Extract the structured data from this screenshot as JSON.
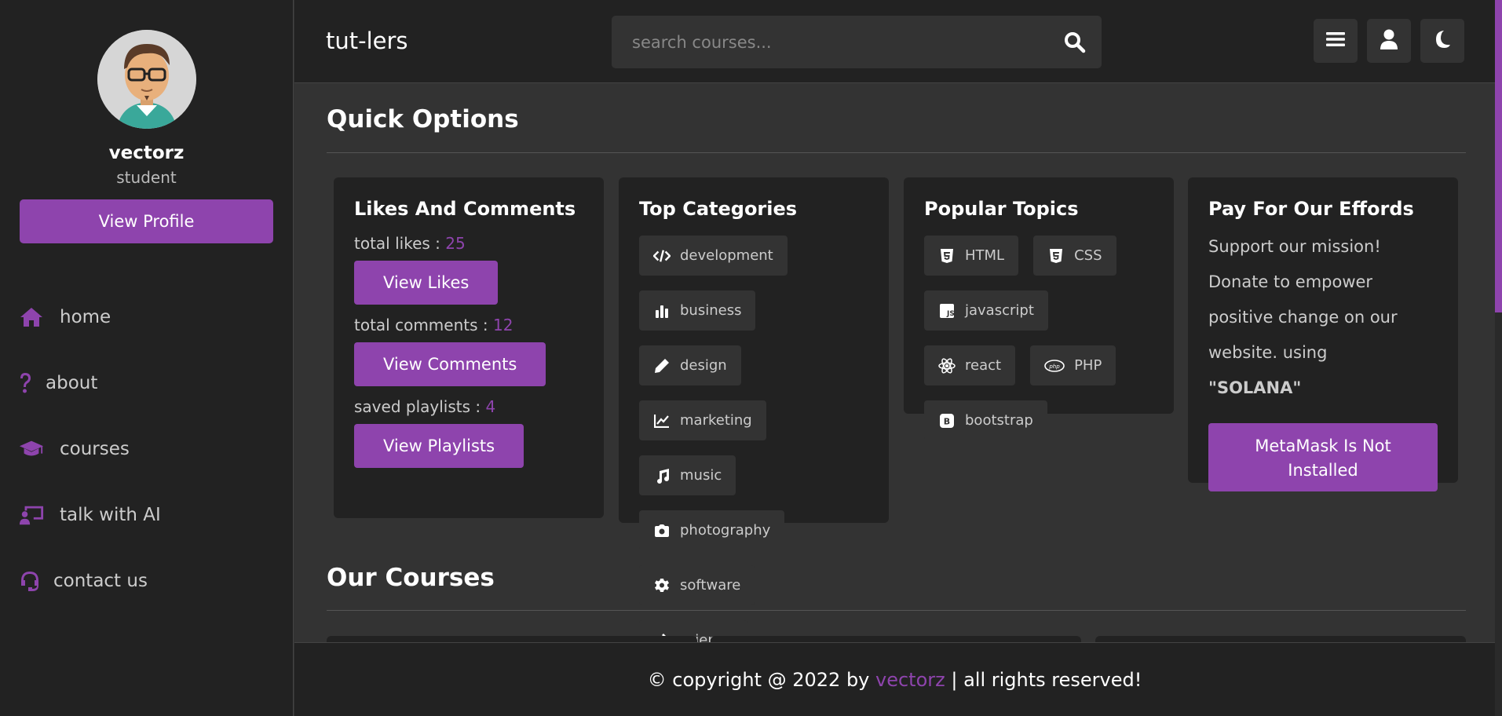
{
  "sidebar": {
    "profile": {
      "name": "vectorz",
      "role": "student",
      "button": "View Profile"
    },
    "nav": [
      {
        "label": "home",
        "icon": "home-icon"
      },
      {
        "label": "about",
        "icon": "question-icon"
      },
      {
        "label": "courses",
        "icon": "graduation-cap-icon"
      },
      {
        "label": "talk with AI",
        "icon": "chalkboard-user-icon"
      },
      {
        "label": "contact us",
        "icon": "headset-icon"
      }
    ]
  },
  "header": {
    "logo": "tut-lers",
    "search_placeholder": "search courses...",
    "buttons": [
      "menu-icon",
      "user-icon",
      "moon-icon"
    ]
  },
  "main": {
    "quick_options_title": "Quick Options",
    "likes_card": {
      "title": "Likes And Comments",
      "likes_label": "total likes : ",
      "likes_value": "25",
      "view_likes": "View Likes",
      "comments_label": "total comments : ",
      "comments_value": "12",
      "view_comments": "View Comments",
      "playlists_label": "saved playlists : ",
      "playlists_value": "4",
      "view_playlists": "View Playlists"
    },
    "categories_card": {
      "title": "Top Categories",
      "tags": [
        {
          "label": "development",
          "icon": "code-icon"
        },
        {
          "label": "business",
          "icon": "chart-bar-icon"
        },
        {
          "label": "design",
          "icon": "pen-icon"
        },
        {
          "label": "marketing",
          "icon": "chart-line-icon"
        },
        {
          "label": "music",
          "icon": "music-icon"
        },
        {
          "label": "photography",
          "icon": "camera-icon"
        },
        {
          "label": "software",
          "icon": "cog-icon"
        },
        {
          "label": "science",
          "icon": "vial-icon"
        }
      ]
    },
    "topics_card": {
      "title": "Popular Topics",
      "tags": [
        {
          "label": "HTML",
          "icon": "html5-icon"
        },
        {
          "label": "CSS",
          "icon": "css3-icon"
        },
        {
          "label": "javascript",
          "icon": "js-icon"
        },
        {
          "label": "react",
          "icon": "react-icon"
        },
        {
          "label": "PHP",
          "icon": "php-icon"
        },
        {
          "label": "bootstrap",
          "icon": "bootstrap-icon"
        }
      ]
    },
    "donate_card": {
      "title": "Pay For Our Effords",
      "text": "Support our mission! Donate to empower positive change on our website. using",
      "highlight": "\"SOLANA\"",
      "button_line1": "MetaMask Is Not",
      "button_line2": "Installed"
    },
    "courses_title": "Our Courses"
  },
  "footer": {
    "prefix": "© copyright @ 2022 by ",
    "brand": "vectorz",
    "suffix": " | all rights reserved!"
  },
  "colors": {
    "accent": "#8e44ad",
    "panel": "#222222",
    "background": "#333333"
  }
}
